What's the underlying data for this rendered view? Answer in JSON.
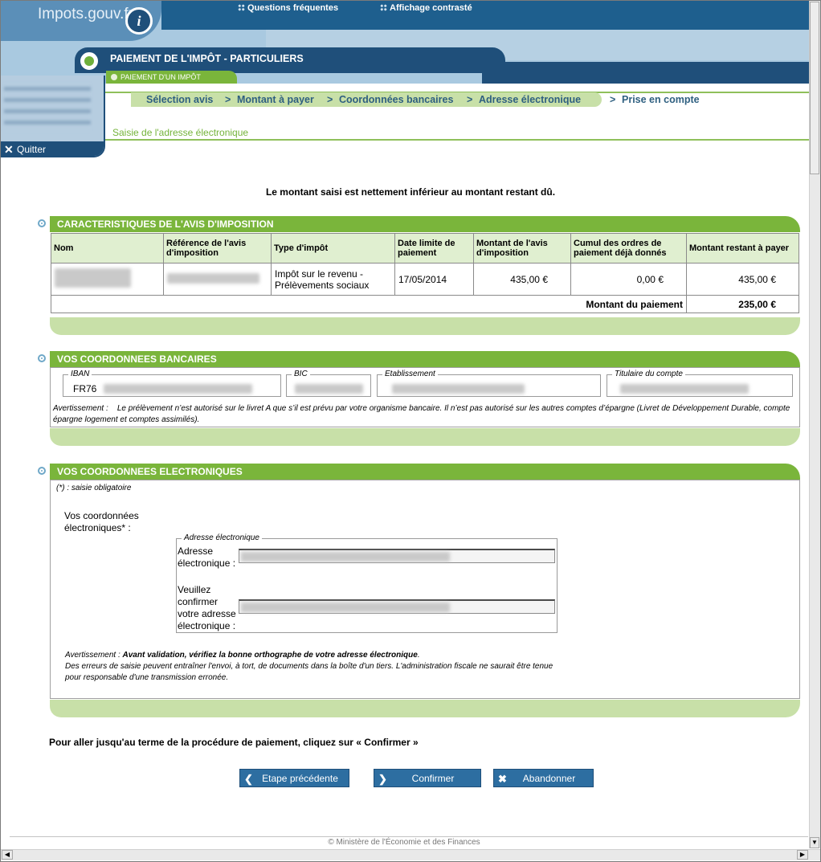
{
  "header": {
    "logo": "Impots.gouv.fr",
    "info_icon": "i",
    "faq": "Questions fréquentes",
    "contrast": "Affichage contrasté",
    "title": "PAIEMENT DE L'IMPÔT - PARTICULIERS",
    "subtab": "PAIEMENT D'UN IMPÔT"
  },
  "sidebar": {
    "quit": "Quitter"
  },
  "breadcrumb": {
    "steps": [
      "Sélection avis",
      "Montant à payer",
      "Coordonnées bancaires",
      "Adresse électronique",
      "Prise en compte"
    ],
    "sep": ">",
    "current_page": "Saisie de l'adresse électronique"
  },
  "notice": "Le montant saisi est nettement inférieur au montant restant dû.",
  "avis": {
    "title": "CARACTERISTIQUES DE L'AVIS D'IMPOSITION",
    "columns": [
      "Nom",
      "Référence de l'avis d'imposition",
      "Type d'impôt",
      "Date limite de paiement",
      "Montant de l'avis d'imposition",
      "Cumul des ordres de paiement déjà donnés",
      "Montant restant à payer"
    ],
    "row": {
      "type_line1": "Impôt sur le revenu -",
      "type_line2": "Prélèvements sociaux",
      "date": "17/05/2014",
      "montant": "435,00 €",
      "cumul": "0,00 €",
      "restant": "435,00 €"
    },
    "total_label": "Montant du paiement",
    "total_value": "235,00 €"
  },
  "bank": {
    "title": "VOS COORDONNEES BANCAIRES",
    "iban_label": "IBAN",
    "iban_prefix": "FR76",
    "bic_label": "BIC",
    "etab_label": "Etablissement",
    "titulaire_label": "Titulaire du compte",
    "avert_label": "Avertissement :",
    "avert_text": "Le prélèvement n’est autorisé sur le livret A que s’il est prévu par votre organisme bancaire. Il n’est pas autorisé sur les autres comptes d’épargne (Livret de Développement Durable, compte épargne logement et comptes assimilés)."
  },
  "elec": {
    "title": "VOS COORDONNEES ELECTRONIQUES",
    "mandatory": "(*) : saisie obligatoire",
    "label_line1": "Vos coordonnées",
    "label_line2": "électroniques* :",
    "fieldset": "Adresse électronique",
    "addr1_line1": "Adresse",
    "addr1_line2": "électronique :",
    "addr2_line1": "Veuillez",
    "addr2_line2": "confirmer",
    "addr2_line3": "votre adresse",
    "addr2_line4": "électronique :",
    "warn_label": "Avertissement :",
    "warn_bold": "Avant validation, vérifiez la bonne orthographe de votre adresse électronique",
    "warn_text": "Des erreurs de saisie peuvent entraîner l'envoi, à tort, de documents dans la boîte d'un tiers. L'administration fiscale ne saurait être tenue pour responsable d'une transmission erronée."
  },
  "instructions": "Pour aller jusqu'au terme de la procédure de paiement, cliquez sur « Confirmer »",
  "buttons": {
    "prev": "Etape précédente",
    "confirm": "Confirmer",
    "cancel": "Abandonner"
  },
  "footer": "© Ministère de l'Économie et des Finances",
  "colors": {
    "green": "#7ab53b",
    "light_green": "#c8e0a8",
    "navy": "#1f4f7a",
    "button_blue": "#2d6ea1"
  }
}
